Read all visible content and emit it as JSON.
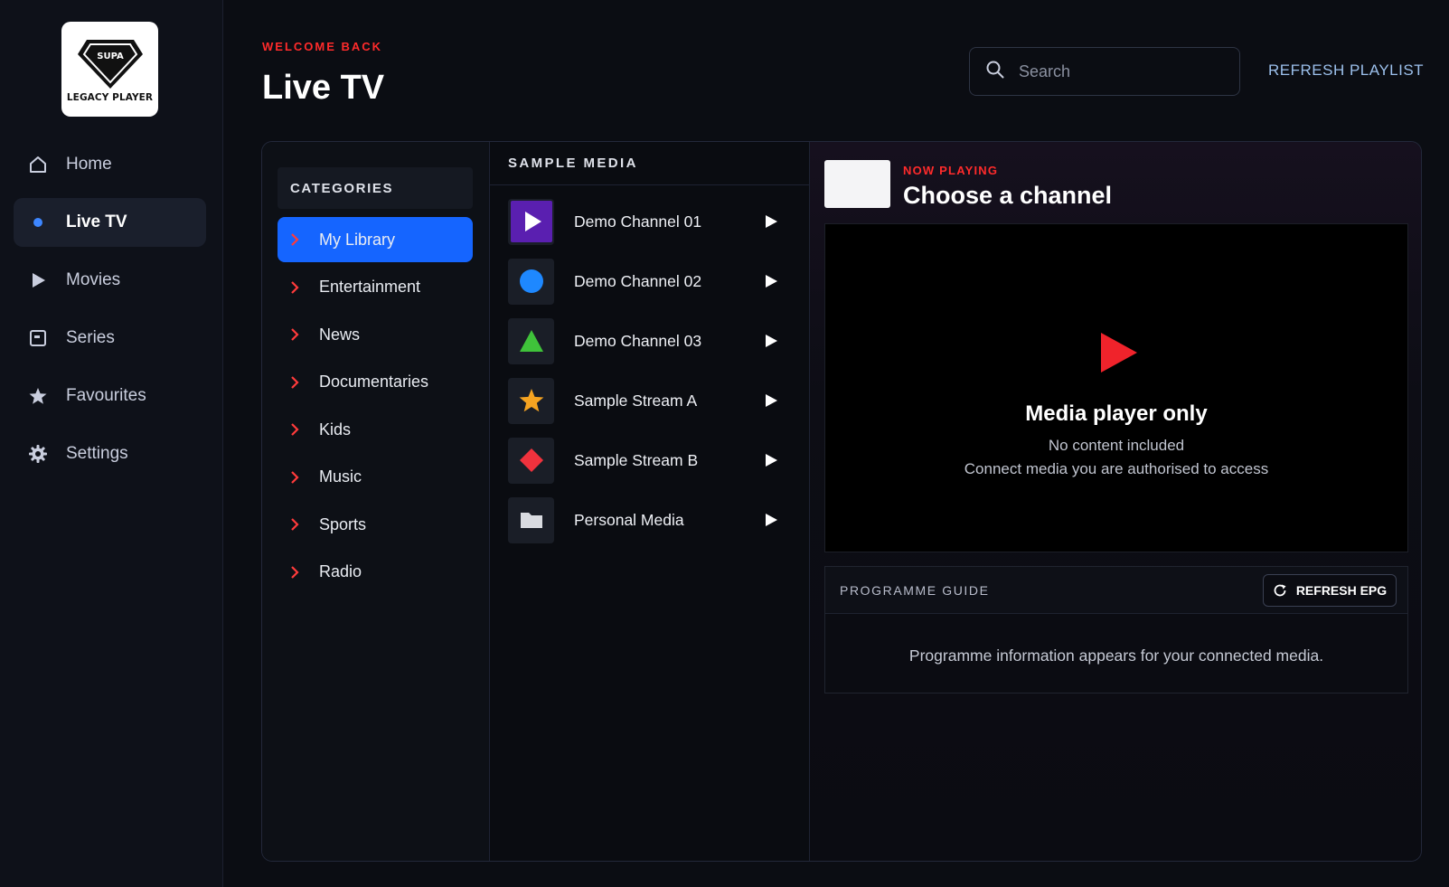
{
  "sidebar": {
    "logo": {
      "top_text": "SUPA",
      "bottom_text": "LEGACY PLAYER"
    },
    "items": [
      {
        "label": "Home",
        "icon": "home-icon"
      },
      {
        "label": "Live TV",
        "icon": "dot-icon",
        "active": true
      },
      {
        "label": "Movies",
        "icon": "play-icon"
      },
      {
        "label": "Series",
        "icon": "series-icon"
      },
      {
        "label": "Favourites",
        "icon": "star-icon"
      },
      {
        "label": "Settings",
        "icon": "gear-icon"
      }
    ]
  },
  "header": {
    "welcome": "WELCOME BACK",
    "title": "Live TV",
    "search_placeholder": "Search",
    "refresh_playlist": "REFRESH PLAYLIST"
  },
  "categories": {
    "header": "CATEGORIES",
    "items": [
      "My Library",
      "Entertainment",
      "News",
      "Documentaries",
      "Kids",
      "Music",
      "Sports",
      "Radio"
    ],
    "active_index": 0
  },
  "media": {
    "header": "SAMPLE MEDIA",
    "items": [
      {
        "title": "Demo Channel 01",
        "icon": "purple-play-icon"
      },
      {
        "title": "Demo Channel 02",
        "icon": "blue-circle-icon"
      },
      {
        "title": "Demo Channel 03",
        "icon": "green-triangle-icon"
      },
      {
        "title": "Sample Stream A",
        "icon": "star-icon"
      },
      {
        "title": "Sample Stream B",
        "icon": "red-diamond-icon"
      },
      {
        "title": "Personal Media",
        "icon": "folder-icon"
      }
    ]
  },
  "now_playing": {
    "label": "NOW PLAYING",
    "title": "Choose a channel"
  },
  "player": {
    "heading": "Media player only",
    "line1": "No content included",
    "line2": "Connect media you are authorised to access"
  },
  "guide": {
    "title": "PROGRAMME GUIDE",
    "refresh_label": "REFRESH EPG",
    "body": "Programme information appears for your connected media."
  },
  "colors": {
    "accent_red": "#ff2b2b",
    "active_blue": "#1565ff",
    "link_blue": "#9cc0ec"
  }
}
